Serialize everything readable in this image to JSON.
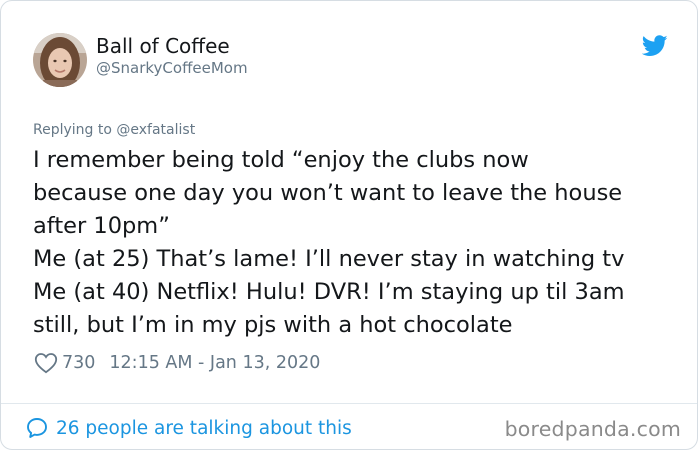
{
  "author": {
    "display_name": "Ball of Coffee",
    "handle": "@SnarkyCoffeeMom"
  },
  "reply": {
    "prefix": "Replying to ",
    "to": "@exfatalist"
  },
  "tweet": {
    "lines": [
      "I remember being told “enjoy the clubs now",
      "because one day you won’t want to leave the house",
      "after 10pm”",
      "Me (at 25) That’s lame! I’ll never stay in watching tv",
      "Me (at 40) Netflix! Hulu! DVR! I’m staying up til 3am",
      "still, but I’m in my pjs with a hot chocolate"
    ]
  },
  "meta": {
    "likes": "730",
    "timestamp": "12:15 AM - Jan 13, 2020"
  },
  "footer": {
    "talking_label": "26 people are talking about this",
    "watermark": "boredpanda.com"
  },
  "colors": {
    "twitter_blue": "#1da1f2",
    "link_blue": "#1b95e0",
    "secondary_text": "#657786"
  },
  "icons": [
    "avatar",
    "twitter-bird-icon",
    "heart-icon",
    "speech-bubble-icon"
  ]
}
